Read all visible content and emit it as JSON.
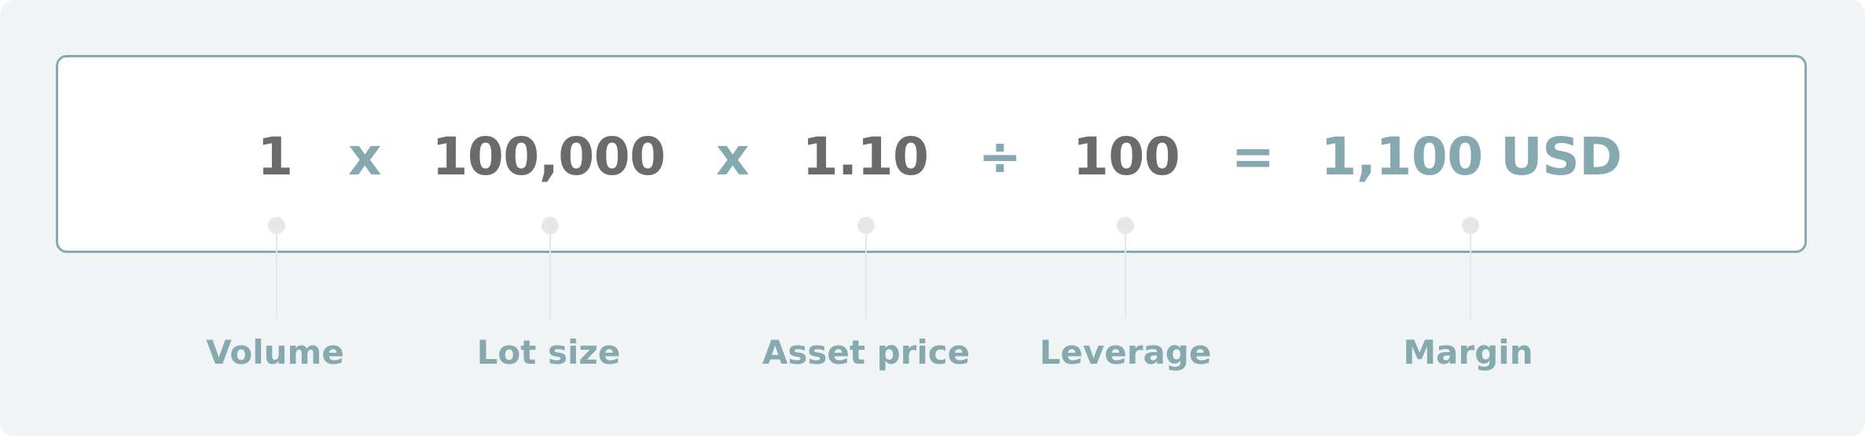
{
  "formula": {
    "volume": "1",
    "op_multiply_1": "x",
    "lot_size": "100,000",
    "op_multiply_2": "x",
    "asset_price": "1.10",
    "op_divide": "÷",
    "leverage": "100",
    "op_equals": "=",
    "margin": "1,100 USD"
  },
  "labels": {
    "volume": "Volume",
    "lot_size": "Lot size",
    "asset_price": "Asset price",
    "leverage": "Leverage",
    "margin": "Margin"
  },
  "colors": {
    "background": "#f1f4f4",
    "box_border": "#86a9b0",
    "value_text": "#6b6b6b",
    "accent": "#86a9b0",
    "connector": "#e5e7e8"
  }
}
